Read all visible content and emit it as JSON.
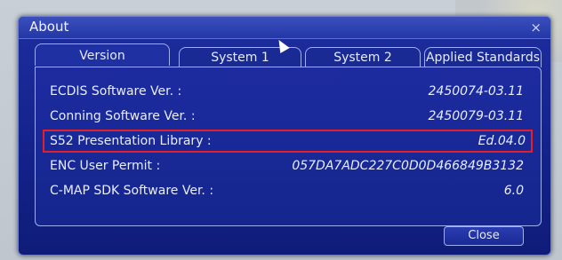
{
  "dialog": {
    "title": "About",
    "close_glyph": "×",
    "tabs": [
      {
        "label": "Version"
      },
      {
        "label": "System 1"
      },
      {
        "label": "System 2"
      },
      {
        "label": "Applied Standards"
      }
    ],
    "rows": [
      {
        "label": "ECDIS Software Ver. :",
        "value": "2450074-03.11"
      },
      {
        "label": "Conning Software Ver. :",
        "value": "2450079-03.11"
      },
      {
        "label": "S52 Presentation Library :",
        "value": "Ed.04.0"
      },
      {
        "label": "ENC User Permit :",
        "value": "057DA7ADC227C0D0D466849B3132"
      },
      {
        "label": "C-MAP SDK Software Ver. :",
        "value": "6.0"
      }
    ],
    "close_button": "Close"
  },
  "colors": {
    "dialog_bg": "#1526a0",
    "highlight_border": "#e1202a",
    "text": "#e9edff"
  }
}
